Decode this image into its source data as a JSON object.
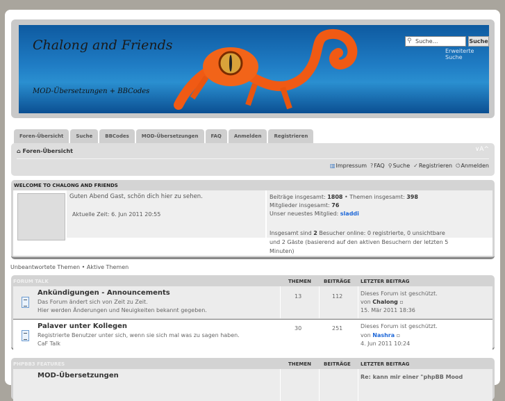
{
  "header": {
    "title": "Chalong and Friends",
    "subtitle": "MOD-Übersetzungen + BBCodes",
    "search_placeholder": "Suche…",
    "search_button": "Suche",
    "advanced_search": "Erweiterte Suche"
  },
  "tabs": [
    "Foren-Übersicht",
    "Suche",
    "BBCodes",
    "MOD-Übersetzungen",
    "FAQ",
    "Anmelden",
    "Registrieren"
  ],
  "nav": {
    "breadcrumb": "Foren-Übersicht",
    "font_size": "∨A^",
    "links": [
      {
        "icon": "book-icon",
        "label": "Impressum"
      },
      {
        "icon": "help-icon",
        "label": "FAQ"
      },
      {
        "icon": "search-icon",
        "label": "Suche"
      },
      {
        "icon": "register-icon",
        "label": "Registrieren"
      },
      {
        "icon": "power-icon",
        "label": "Anmelden"
      }
    ]
  },
  "welcome": {
    "title": "WELCOME TO CHALONG AND FRIENDS",
    "greeting": "Guten Abend Gast, schön dich hier zu sehen.",
    "time": "Aktuelle Zeit: 6. Jun 2011 20:55",
    "posts_label": "Beiträge insgesamt:",
    "posts": "1808",
    "topics_label": "• Themen insgesamt:",
    "topics": "398",
    "members_label": "Mitglieder insgesamt:",
    "members": "76",
    "newest_label": "Unser neuestes Mitglied:",
    "newest": "sladdi",
    "online_1": "Insgesamt sind",
    "online_count": "2",
    "online_2": "Besucher online: 0 registrierte, 0 unsichtbare",
    "online_3": "und 2 Gäste (basierend auf den aktiven Besuchern der letzten 5",
    "online_4": "Minuten)"
  },
  "quicklinks": "Unbeantwortete Themen • Aktive Themen",
  "categories": [
    {
      "name": "FORUM TALK",
      "col_topics": "THEMEN",
      "col_posts": "BEITRÄGE",
      "col_last": "LETZTER BEITRAG",
      "forums": [
        {
          "name": "Ankündigungen - Announcements",
          "desc1": "Das Forum ändert sich von Zeit zu Zeit.",
          "desc2": "Hier werden Änderungen und Neuigkeiten bekannt gegeben.",
          "topics": "13",
          "posts": "112",
          "last1": "Dieses Forum ist geschützt.",
          "by": "von",
          "user": "Chalong",
          "date": "15. Mär 2011 18:36"
        },
        {
          "name": "Palaver unter Kollegen",
          "desc1": "Registrierte Benutzer unter sich, wenn sie sich mal was zu sagen haben.",
          "desc2": "CaF Talk",
          "topics": "30",
          "posts": "251",
          "last1": "Dieses Forum ist geschützt.",
          "by": "von",
          "user": "Nashra",
          "date": "4. Jun 2011 10:24"
        }
      ]
    },
    {
      "name": "PHPBB3 FEATURES",
      "col_topics": "THEMEN",
      "col_posts": "BEITRÄGE",
      "col_last": "LETZTER BEITRAG",
      "forums": [
        {
          "name": "MOD-Übersetzungen",
          "last1": "Re: kann mir einer \"phpBB Mood"
        }
      ]
    }
  ]
}
